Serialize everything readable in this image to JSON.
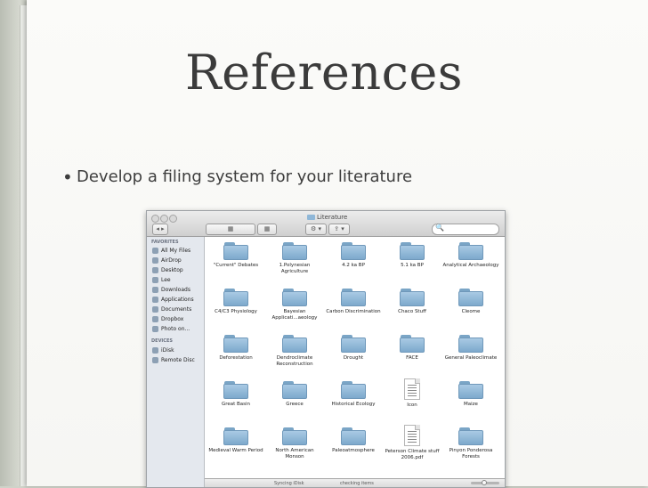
{
  "slide": {
    "title": "References",
    "bullet": "Develop a filing system for your literature"
  },
  "finder": {
    "window_title": "Literature",
    "search_placeholder": "🔍",
    "toolbar": {
      "back_label": "◂ ▸",
      "view_label": "▦",
      "action_label": "⚙ ▾",
      "share_label": "⇪ ▾"
    },
    "sidebar": {
      "favorites_header": "FAVORITES",
      "favorites": [
        "All My Files",
        "AirDrop",
        "Desktop",
        "Lee",
        "Downloads",
        "Applications",
        "Documents",
        "Dropbox",
        "Photo on..."
      ],
      "devices_header": "DEVICES",
      "devices": [
        "iDisk",
        "Remote Disc"
      ]
    },
    "items": [
      {
        "label": "\"Current\" Debates",
        "type": "folder"
      },
      {
        "label": "1.Polynesian Agriculture",
        "type": "folder"
      },
      {
        "label": "4.2 ka BP",
        "type": "folder"
      },
      {
        "label": "5.1 ka BP",
        "type": "folder"
      },
      {
        "label": "Analytical Archaeology",
        "type": "folder"
      },
      {
        "label": "C4/C3 Physiology",
        "type": "folder"
      },
      {
        "label": "Bayesian Applicati...aeology",
        "type": "folder"
      },
      {
        "label": "Carbon Discrimination",
        "type": "folder"
      },
      {
        "label": "Chaco Stuff",
        "type": "folder"
      },
      {
        "label": "Cleome",
        "type": "folder"
      },
      {
        "label": "Deforestation",
        "type": "folder"
      },
      {
        "label": "Dendroclimate Reconstruction",
        "type": "folder"
      },
      {
        "label": "Drought",
        "type": "folder"
      },
      {
        "label": "FACE",
        "type": "folder"
      },
      {
        "label": "General Paleoclimate",
        "type": "folder"
      },
      {
        "label": "Great Basin",
        "type": "folder"
      },
      {
        "label": "Greece",
        "type": "folder"
      },
      {
        "label": "Historical Ecology",
        "type": "folder"
      },
      {
        "label": "Icon",
        "type": "document"
      },
      {
        "label": "Maize",
        "type": "folder"
      },
      {
        "label": "Medieval Warm Period",
        "type": "folder"
      },
      {
        "label": "North American Monson",
        "type": "folder"
      },
      {
        "label": "Paleoatmosphere",
        "type": "folder"
      },
      {
        "label": "Peterson Climate stuff 2006.pdf",
        "type": "document"
      },
      {
        "label": "Pinyon Ponderosa Forests",
        "type": "folder"
      }
    ],
    "status": {
      "sync_text": "Syncing iDisk",
      "checking_text": "checking items"
    }
  }
}
